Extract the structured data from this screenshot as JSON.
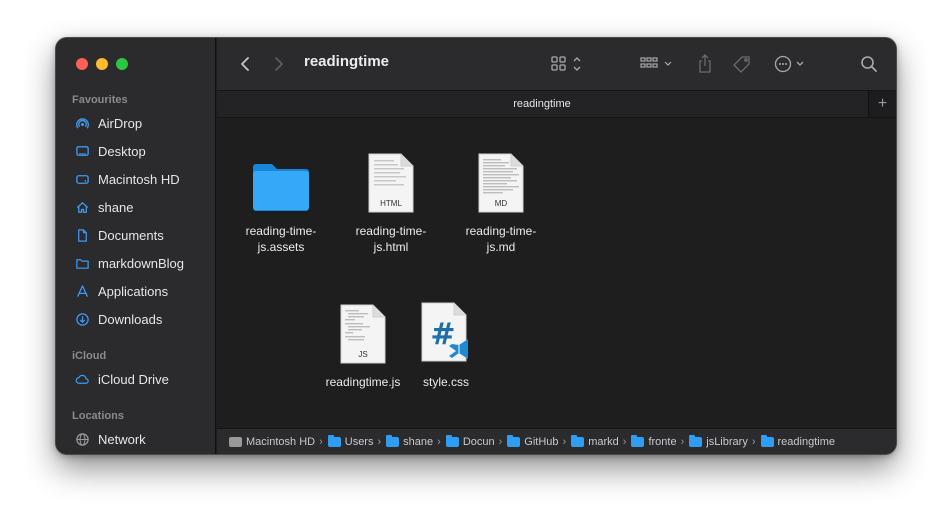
{
  "window": {
    "title": "readingtime",
    "tab_title": "readingtime"
  },
  "sidebar": {
    "favourites_label": "Favourites",
    "favourites": [
      {
        "label": "AirDrop",
        "icon": "airdrop-icon"
      },
      {
        "label": "Desktop",
        "icon": "desktop-icon"
      },
      {
        "label": "Macintosh HD",
        "icon": "disk-icon"
      },
      {
        "label": "shane",
        "icon": "home-icon"
      },
      {
        "label": "Documents",
        "icon": "document-icon"
      },
      {
        "label": "markdownBlog",
        "icon": "folder-icon"
      },
      {
        "label": "Applications",
        "icon": "applications-icon"
      },
      {
        "label": "Downloads",
        "icon": "downloads-icon"
      }
    ],
    "icloud_label": "iCloud",
    "icloud": [
      {
        "label": "iCloud Drive",
        "icon": "cloud-icon"
      }
    ],
    "locations_label": "Locations",
    "locations": [
      {
        "label": "Network",
        "icon": "globe-icon"
      }
    ]
  },
  "toolbar": {
    "tab_add": "+"
  },
  "files": [
    {
      "line1": "reading-time-",
      "line2": "js.assets",
      "kind": "folder"
    },
    {
      "line1": "reading-time-",
      "line2": "js.html",
      "kind": "html",
      "badge": "HTML"
    },
    {
      "line1": "reading-time-",
      "line2": "js.md",
      "kind": "md",
      "badge": "MD"
    },
    {
      "line1": "readingtime.js",
      "line2": "",
      "kind": "js",
      "badge": "JS"
    },
    {
      "line1": "style.css",
      "line2": "",
      "kind": "css"
    }
  ],
  "pathbar": [
    {
      "label": "Macintosh HD",
      "kind": "disk"
    },
    {
      "label": "Users",
      "kind": "folder"
    },
    {
      "label": "shane",
      "kind": "folder"
    },
    {
      "label": "Docun",
      "kind": "folder"
    },
    {
      "label": "GitHub",
      "kind": "folder"
    },
    {
      "label": "markd",
      "kind": "folder"
    },
    {
      "label": "fronte",
      "kind": "folder"
    },
    {
      "label": "jsLibrary",
      "kind": "folder"
    },
    {
      "label": "readingtime",
      "kind": "folder"
    }
  ],
  "colors": {
    "accent": "#2f9df4",
    "sidebar_bg": "#2b2a2d",
    "content_bg": "#1e1e1e"
  }
}
